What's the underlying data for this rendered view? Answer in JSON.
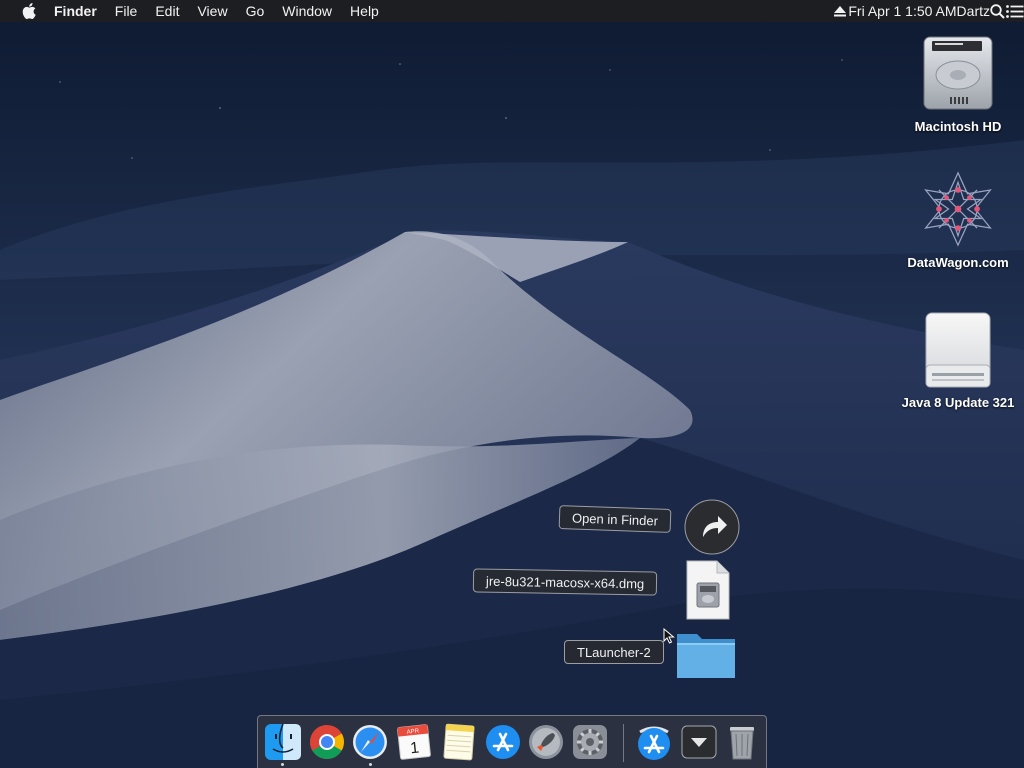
{
  "menubar": {
    "app_name": "Finder",
    "menus": [
      "File",
      "Edit",
      "View",
      "Go",
      "Window",
      "Help"
    ],
    "clock": "Fri Apr 1  1:50 AM",
    "user": "Dartz"
  },
  "desktop": {
    "icons": [
      {
        "label": "Macintosh HD",
        "icon": "hard-drive-icon"
      },
      {
        "label": "DataWagon.com",
        "icon": "network-share-icon"
      },
      {
        "label": "Java 8 Update 321",
        "icon": "disk-image-volume-icon"
      }
    ]
  },
  "stack": {
    "items": [
      {
        "label": "Open in Finder",
        "icon": "open-in-finder-icon"
      },
      {
        "label": "jre-8u321-macosx-x64.dmg",
        "icon": "dmg-file-icon"
      },
      {
        "label": "TLauncher-2",
        "icon": "folder-icon"
      }
    ]
  },
  "dock": {
    "calendar_month": "APR",
    "calendar_day": "1",
    "items": [
      {
        "name": "Finder",
        "icon": "finder-icon",
        "running": true
      },
      {
        "name": "Google Chrome",
        "icon": "chrome-icon",
        "running": false
      },
      {
        "name": "Safari",
        "icon": "safari-icon",
        "running": true
      },
      {
        "name": "Calendar",
        "icon": "calendar-icon",
        "running": false
      },
      {
        "name": "Notes",
        "icon": "notes-icon",
        "running": false
      },
      {
        "name": "App Store",
        "icon": "app-store-icon",
        "running": false
      },
      {
        "name": "Launchpad",
        "icon": "launchpad-icon",
        "running": false
      },
      {
        "name": "System Preferences",
        "icon": "system-preferences-icon",
        "running": false
      },
      {
        "name": "Applications",
        "icon": "applications-stack-icon",
        "running": false
      },
      {
        "name": "Downloads",
        "icon": "downloads-stack-icon",
        "running": false
      },
      {
        "name": "Trash",
        "icon": "trash-icon",
        "running": false
      }
    ]
  },
  "colors": {
    "sky_top": "#0f1b33",
    "sky_bottom": "#2a3c62",
    "dune_light": "#8e96a8",
    "dune_shadow": "#1f2c4b",
    "folder_blue": "#5aa8e0",
    "menubar_bg": "#1e1e20"
  }
}
